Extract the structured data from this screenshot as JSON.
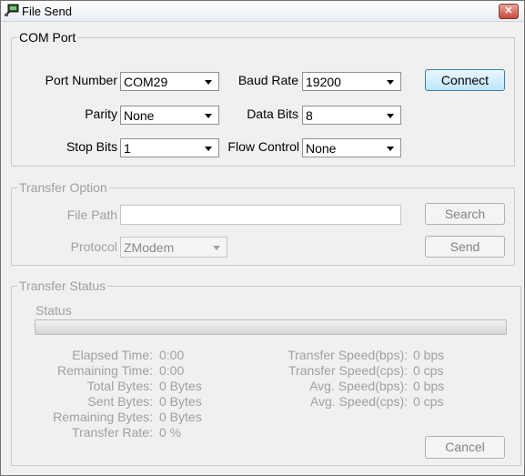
{
  "window": {
    "title": "File Send",
    "close_symbol": "✕"
  },
  "com_port": {
    "legend": "COM Port",
    "port_number": {
      "label": "Port Number",
      "value": "COM29"
    },
    "baud_rate": {
      "label": "Baud Rate",
      "value": "19200"
    },
    "parity": {
      "label": "Parity",
      "value": "None"
    },
    "data_bits": {
      "label": "Data Bits",
      "value": "8"
    },
    "stop_bits": {
      "label": "Stop Bits",
      "value": "1"
    },
    "flow_control": {
      "label": "Flow Control",
      "value": "None"
    },
    "connect_label": "Connect"
  },
  "transfer_option": {
    "legend": "Transfer Option",
    "file_path_label": "File Path",
    "file_path_value": "",
    "protocol_label": "Protocol",
    "protocol_value": "ZModem",
    "search_label": "Search",
    "send_label": "Send"
  },
  "transfer_status": {
    "legend": "Transfer Status",
    "status_label": "Status",
    "progress_fraction": 0,
    "left": [
      {
        "label": "Elapsed Time:",
        "value": "0:00"
      },
      {
        "label": "Remaining Time:",
        "value": "0:00"
      },
      {
        "label": "Total Bytes:",
        "value": "0 Bytes"
      },
      {
        "label": "Sent Bytes:",
        "value": "0 Bytes"
      },
      {
        "label": "Remaining Bytes:",
        "value": "0 Bytes"
      },
      {
        "label": "Transfer Rate:",
        "value": "0 %"
      }
    ],
    "right": [
      {
        "label": "Transfer Speed(bps):",
        "value": "0 bps"
      },
      {
        "label": "Transfer Speed(cps):",
        "value": "0 cps"
      },
      {
        "label": "Avg. Speed(bps):",
        "value": "0 bps"
      },
      {
        "label": "Avg. Speed(cps):",
        "value": "0 cps"
      }
    ],
    "cancel_label": "Cancel"
  },
  "colors": {
    "progress_fill": "#06b025",
    "disabled_text": "#a0a0a0",
    "connect_accent": "#3c7fb1"
  }
}
